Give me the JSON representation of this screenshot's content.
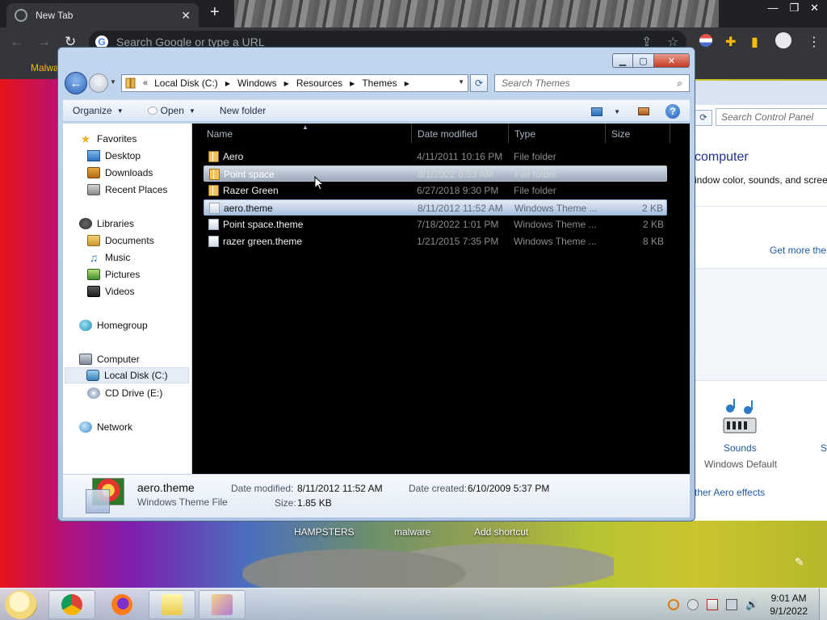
{
  "browser": {
    "tab_title": "New Tab",
    "omnibox_placeholder": "Search Google or type a URL",
    "bookmark": "Malwa"
  },
  "control_panel": {
    "search_placeholder": "Search Control Panel",
    "heading": "computer",
    "subtext": "indow color, sounds, and scree",
    "get_more": "Get more the",
    "sounds_label": "Sounds",
    "sounds_sub": "Windows Default",
    "s_label": "S",
    "aero_link": "ther Aero effects"
  },
  "desktop": {
    "shortcuts": [
      "HAMPSTERS",
      "malware",
      "Add shortcut"
    ]
  },
  "explorer": {
    "breadcrumb": [
      "Local Disk (C:)",
      "Windows",
      "Resources",
      "Themes"
    ],
    "search_placeholder": "Search Themes",
    "toolbar": {
      "organize": "Organize",
      "open": "Open",
      "new_folder": "New folder"
    },
    "nav": {
      "favorites": "Favorites",
      "desktop": "Desktop",
      "downloads": "Downloads",
      "recent": "Recent Places",
      "libraries": "Libraries",
      "documents": "Documents",
      "music": "Music",
      "pictures": "Pictures",
      "videos": "Videos",
      "homegroup": "Homegroup",
      "computer": "Computer",
      "local_disk": "Local Disk (C:)",
      "cd_drive": "CD Drive (E:)",
      "network": "Network"
    },
    "columns": {
      "name": "Name",
      "date": "Date modified",
      "type": "Type",
      "size": "Size"
    },
    "files": [
      {
        "name": "Aero",
        "date": "4/11/2011 10:16 PM",
        "type": "File folder",
        "size": ""
      },
      {
        "name": "Point space",
        "date": "8/1/2022 8:53 AM",
        "type": "File folder",
        "size": ""
      },
      {
        "name": "Razer Green",
        "date": "6/27/2018 9:30 PM",
        "type": "File folder",
        "size": ""
      },
      {
        "name": "aero.theme",
        "date": "8/11/2012 11:52 AM",
        "type": "Windows Theme ...",
        "size": "2 KB"
      },
      {
        "name": "Point space.theme",
        "date": "7/18/2022 1:01 PM",
        "type": "Windows Theme ...",
        "size": "2 KB"
      },
      {
        "name": "razer green.theme",
        "date": "1/21/2015 7:35 PM",
        "type": "Windows Theme ...",
        "size": "8 KB"
      }
    ],
    "details": {
      "title": "aero.theme",
      "subtitle": "Windows Theme File",
      "date_modified_label": "Date modified:",
      "date_modified": "8/11/2012 11:52 AM",
      "date_created_label": "Date created:",
      "date_created": "6/10/2009 5:37 PM",
      "size_label": "Size:",
      "size": "1.85 KB"
    }
  },
  "taskbar": {
    "time": "9:01 AM",
    "date": "9/1/2022"
  }
}
